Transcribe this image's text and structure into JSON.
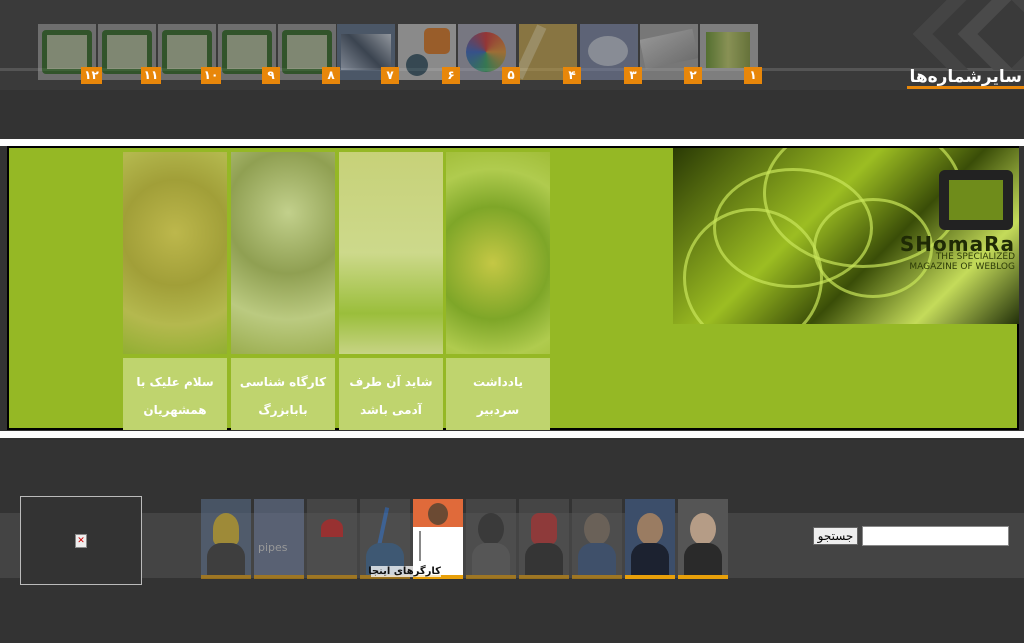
{
  "header": {
    "other_issues_title": "سایرشماره‌ها",
    "issue_numbers": [
      "۱",
      "۲",
      "۳",
      "۴",
      "۵",
      "۶",
      "۷",
      "۸",
      "۹",
      "۱۰",
      "۱۱",
      "۱۲"
    ]
  },
  "banner": {
    "logo_text": "SHomaRa",
    "logo_subtitle": "THE SPECIALIZED MAGAZINE OF WEBLOG",
    "cards": [
      {
        "title": "یادداشت سردبیر"
      },
      {
        "title": "شاید آن طرف آدمی باشد"
      },
      {
        "title": "کارگاه شناسی بابابزرگ"
      },
      {
        "title": "سلام علیک با همشهریان"
      }
    ]
  },
  "bottom": {
    "author_label": "کارگرهای اینجا",
    "search": {
      "button_label": "جستجو",
      "placeholder": ""
    }
  },
  "colors": {
    "accent": "#e8870a",
    "banner_green": "#95b825",
    "background": "#333333"
  }
}
